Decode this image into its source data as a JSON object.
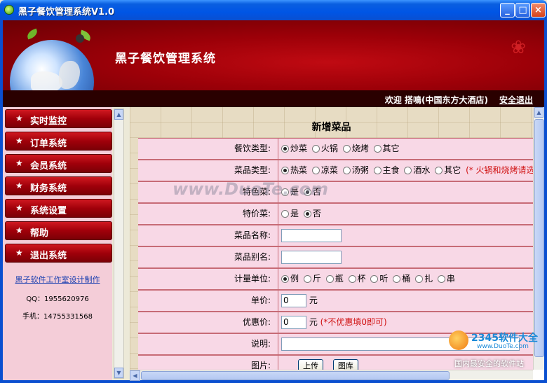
{
  "window": {
    "title": "黑子餐饮管理系统V1.0",
    "min_glyph": "_",
    "max_glyph": "□",
    "close_glyph": "×"
  },
  "banner": {
    "title": "黑子餐饮管理系统"
  },
  "welcome": {
    "text": "欢迎  搭鳴(中国东方大酒店)",
    "logout": "安全退出"
  },
  "sidebar": {
    "items": [
      {
        "label": "实时监控"
      },
      {
        "label": "订单系统"
      },
      {
        "label": "会员系统"
      },
      {
        "label": "财务系统"
      },
      {
        "label": "系统设置"
      },
      {
        "label": "帮助"
      },
      {
        "label": "退出系统"
      }
    ],
    "credit_link": "黑子软件工作室设计制作",
    "qq": "QQ：1955620976",
    "phone": "手机：14755331568"
  },
  "form": {
    "title": "新增菜品",
    "rows": {
      "meal_type": {
        "label": "餐饮类型:",
        "options": [
          "炒菜",
          "火锅",
          "烧烤",
          "其它"
        ],
        "selected": "炒菜"
      },
      "dish_type": {
        "label": "菜品类型:",
        "options": [
          "热菜",
          "凉菜",
          "汤粥",
          "主食",
          "酒水",
          "其它"
        ],
        "selected": "热菜",
        "note": "(* 火锅和烧烤请选择"
      },
      "special": {
        "label": "特色菜:",
        "options": [
          "是",
          "否"
        ],
        "selected": "否"
      },
      "discount": {
        "label": "特价菜:",
        "options": [
          "是",
          "否"
        ],
        "selected": "否"
      },
      "name": {
        "label": "菜品名称:",
        "value": ""
      },
      "alias": {
        "label": "菜品别名:",
        "value": ""
      },
      "unit": {
        "label": "计量单位:",
        "options": [
          "例",
          "斤",
          "瓶",
          "杯",
          "听",
          "桶",
          "扎",
          "串"
        ],
        "selected": "例"
      },
      "price": {
        "label": "单价:",
        "value": "0",
        "suffix": "元"
      },
      "member_price": {
        "label": "优惠价:",
        "value": "0",
        "suffix": "元",
        "note": "(*不优惠填0即可)"
      },
      "description": {
        "label": "说明:",
        "value": ""
      },
      "image": {
        "label": "图片:",
        "upload": "上传",
        "gallery": "图库"
      }
    }
  },
  "watermark": "www.DuoTe.com",
  "brand": {
    "num": "2345软件大全",
    "site": "www.DuoTe.com",
    "slogan": "国内最安全的软件站"
  }
}
